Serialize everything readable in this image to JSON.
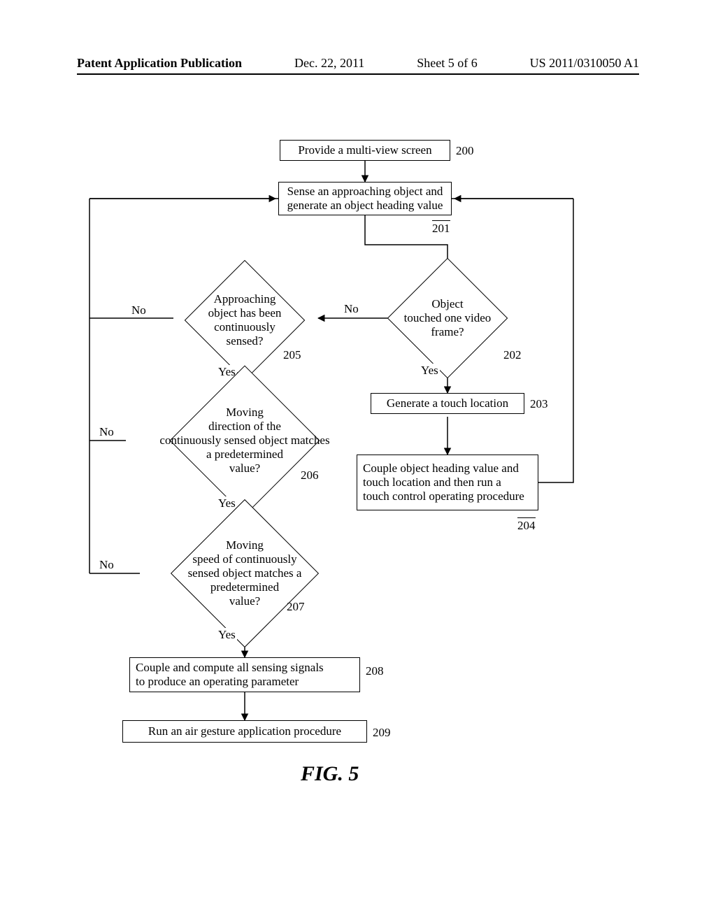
{
  "header": {
    "title": "Patent Application Publication",
    "date": "Dec. 22, 2011",
    "sheet": "Sheet 5 of 6",
    "pubno": "US 2011/0310050 A1"
  },
  "figure_label": "FIG. 5",
  "refs": {
    "n200": "200",
    "n201": "201",
    "n202": "202",
    "n203": "203",
    "n204": "204",
    "n205": "205",
    "n206": "206",
    "n207": "207",
    "n208": "208",
    "n209": "209"
  },
  "nodes": {
    "n200": "Provide a multi-view screen",
    "n201": "Sense an approaching object and\ngenerate an object heading value",
    "n202": "Object\ntouched one video\nframe?",
    "n203": "Generate a touch location",
    "n204": "Couple object heading value and\ntouch location and then run a\ntouch control operating procedure",
    "n205": "Approaching\nobject has been\ncontinuously\nsensed?",
    "n206": "Moving\ndirection of the\ncontinuously sensed object matches\na predetermined\nvalue?",
    "n207": "Moving\nspeed of continuously\nsensed object matches a\npredetermined\nvalue?",
    "n208": "Couple and compute all sensing signals\nto produce an operating parameter",
    "n209": "Run an air gesture application procedure"
  },
  "edges": {
    "yes": "Yes",
    "no": "No"
  }
}
